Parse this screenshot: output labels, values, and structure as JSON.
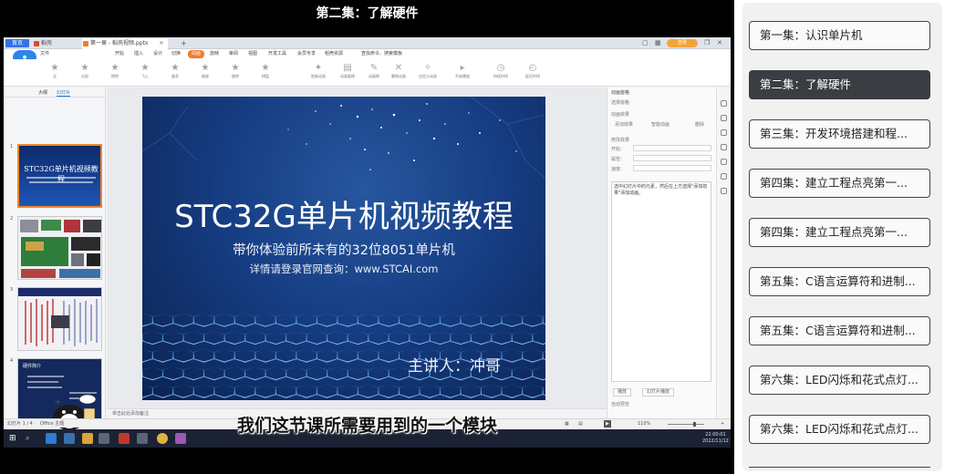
{
  "video": {
    "title": "第二集：了解硬件",
    "subtitle": "我们这节课所需要用到的一个模块"
  },
  "wps": {
    "home_tab": "首页",
    "tab_daoke": "稻壳",
    "doc_tab": "第一章 - 稻壳视频.pptx",
    "login_label": "登录",
    "menu": [
      "文件",
      "开始",
      "插入",
      "设计",
      "切换",
      "动画",
      "放映",
      "审阅",
      "视图",
      "开发工具",
      "会员专享",
      "稻壳资源"
    ],
    "active_menu": "动画",
    "search": "查找命令、搜索模板",
    "ribbon_labels": [
      "无",
      "出现",
      "擦除",
      "飞入",
      "盒状",
      "缩放",
      "旋转",
      "棋盘",
      "智能动画",
      "动画窗格",
      "动画刷",
      "删除动画",
      "自定义动画",
      "开始播放",
      "持续时间",
      "延迟时间"
    ],
    "left_tabs": [
      "大纲",
      "幻灯片"
    ],
    "slide_numbers": [
      "1",
      "2",
      "3",
      "4"
    ],
    "notes_placeholder": "单击此处添加备注",
    "status_slide": "幻灯片 1 / 4",
    "status_theme": "Office 主题",
    "zoom": "110%",
    "right_pane": {
      "title": "动画窗格",
      "select_pane": "选择窗格",
      "anim_label": "动画效果",
      "add_effect": "添加效果",
      "smart_anim": "智能动画",
      "delete": "删除",
      "modify": "修改效果",
      "start": "开始：",
      "property": "属性：",
      "speed": "速度：",
      "notes_text": "选中幻灯片中的元素，然后在上方选择\"添加效果\"添加动画。",
      "play_btn": "播放",
      "preview_btn": "幻灯片播放",
      "autopreview": "自动预览"
    },
    "clock_time": "22:00:01",
    "clock_date": "2022/11/12"
  },
  "slide": {
    "title": "STC32G单片机视频教程",
    "subtitle": "带你体验前所未有的32位8051单片机",
    "url_line": "详情请登录官网查询：www.STCAI.com",
    "presenter": "主讲人：冲哥"
  },
  "thumbnails": {
    "t1_title": "STC32G单片机视频教程",
    "t4_title": "硬件简介"
  },
  "playlist": [
    {
      "label": "第一集：认识单片机"
    },
    {
      "label": "第二集：了解硬件"
    },
    {
      "label": "第三集：开发环境搭建和程..."
    },
    {
      "label": "第四集：建立工程点亮第一..."
    },
    {
      "label": "第四集：建立工程点亮第一..."
    },
    {
      "label": "第五集：C语言运算符和进制..."
    },
    {
      "label": "第五集：C语言运算符和进制..."
    },
    {
      "label": "第六集：LED闪烁和花式点灯..."
    },
    {
      "label": "第六集：LED闪烁和花式点灯..."
    }
  ],
  "playlist_active_index": 1,
  "colors": {
    "accent_orange": "#f07b30",
    "wps_blue": "#3572e0",
    "active_episode": "#3a3d42",
    "slide_blue": "#163d83"
  }
}
